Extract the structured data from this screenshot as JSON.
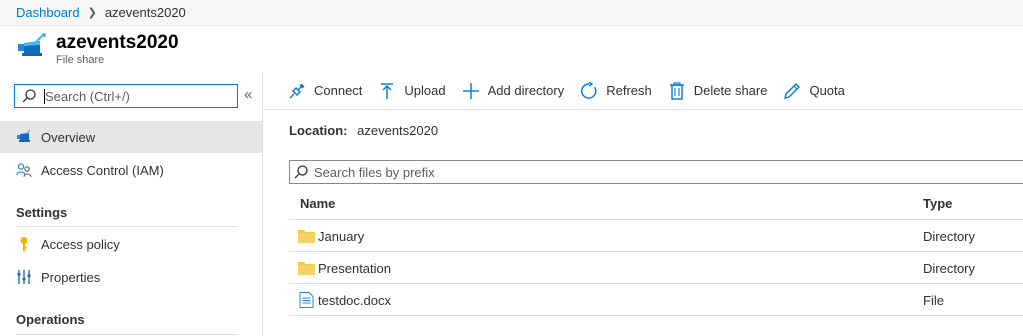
{
  "breadcrumb": {
    "root": "Dashboard",
    "current": "azevents2020"
  },
  "header": {
    "title": "azevents2020",
    "subtitle": "File share"
  },
  "sidebar": {
    "search_placeholder": "Search (Ctrl+/)",
    "collapse_glyph": "«",
    "items": [
      {
        "label": "Overview",
        "icon": "file-share-icon",
        "active": true
      },
      {
        "label": "Access Control (IAM)",
        "icon": "people-icon",
        "active": false
      }
    ],
    "sections": [
      {
        "title": "Settings",
        "items": [
          {
            "label": "Access policy",
            "icon": "key-icon"
          },
          {
            "label": "Properties",
            "icon": "sliders-icon"
          }
        ]
      },
      {
        "title": "Operations",
        "items": []
      }
    ]
  },
  "toolbar": {
    "connect": "Connect",
    "upload": "Upload",
    "add_directory": "Add directory",
    "refresh": "Refresh",
    "delete_share": "Delete share",
    "quota": "Quota"
  },
  "location": {
    "label": "Location:",
    "value": "azevents2020"
  },
  "file_search": {
    "placeholder": "Search files by prefix"
  },
  "table": {
    "columns": [
      "Name",
      "Type"
    ],
    "rows": [
      {
        "name": "January",
        "type": "Directory",
        "icon": "folder-icon"
      },
      {
        "name": "Presentation",
        "type": "Directory",
        "icon": "folder-icon"
      },
      {
        "name": "testdoc.docx",
        "type": "File",
        "icon": "document-icon"
      }
    ]
  },
  "colors": {
    "accent": "#0078d4",
    "folder": "#f2c94c",
    "key": "#f2b200",
    "icon_blue": "#2b88d8"
  }
}
